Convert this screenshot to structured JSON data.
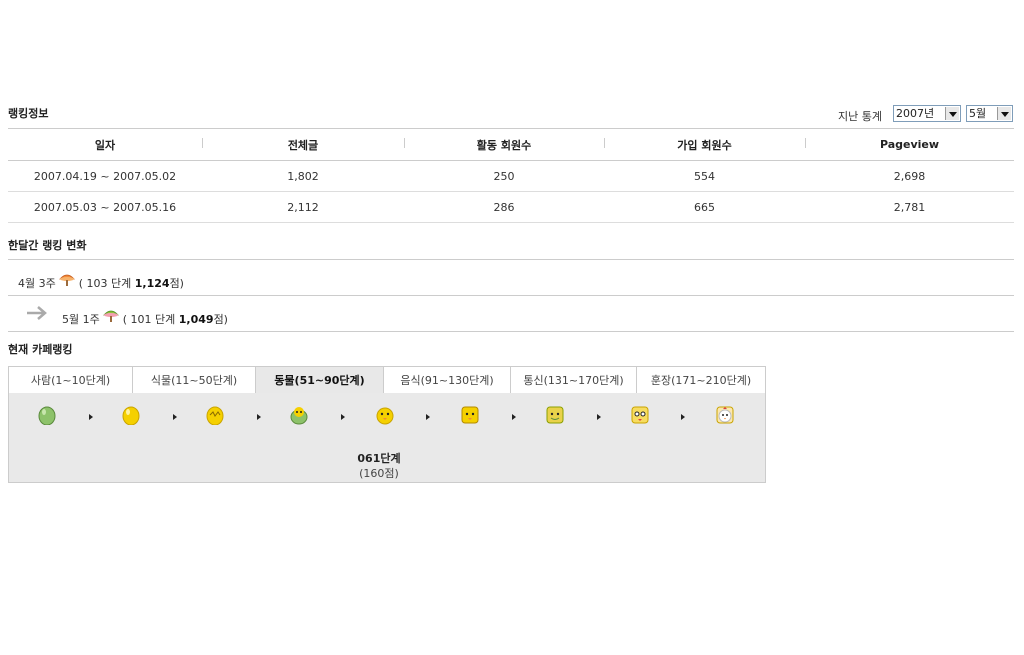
{
  "ranking_info": {
    "title": "랭킹정보",
    "stats_label": "지난 통계",
    "year_select": "2007년",
    "month_select": "5월",
    "headers": [
      "일자",
      "전체글",
      "활동 회원수",
      "가입 회원수",
      "Pageview"
    ],
    "rows": [
      [
        "2007.04.19 ~ 2007.05.02",
        "1,802",
        "250",
        "554",
        "2,698"
      ],
      [
        "2007.05.03 ~ 2007.05.16",
        "2,112",
        "286",
        "665",
        "2,781"
      ]
    ]
  },
  "monthly_change": {
    "title": "한달간 랭킹 변화",
    "rows": [
      {
        "period": "4월 3주",
        "stage_open": "( 103 단계 ",
        "score": "1,124",
        "score_suffix": "점)"
      },
      {
        "period": "5월 1주",
        "stage_open": "( 101 단계 ",
        "score": "1,049",
        "score_suffix": "점)"
      }
    ]
  },
  "current_ranking": {
    "title": "현재 카페랭킹",
    "tabs": [
      "사람(1~10단계)",
      "식물(11~50단계)",
      "동물(51~90단계)",
      "음식(91~130단계)",
      "통신(131~170단계)",
      "훈장(171~210단계)"
    ],
    "active_tab": "동물(51~90단계)",
    "stage_name": "061단계",
    "stage_score": "(160점)",
    "icons": [
      "green-egg-icon",
      "yellow-egg-icon",
      "cracked-egg-icon",
      "hatching-chick-icon",
      "chick-icon",
      "chick-square-icon",
      "chick-square-icon-2",
      "chick-face-icon",
      "chicken-icon"
    ]
  },
  "colors": {
    "active_tab_bg": "#e8e8e8",
    "panel_bg": "#e9e9e9",
    "border": "#cccccc"
  }
}
